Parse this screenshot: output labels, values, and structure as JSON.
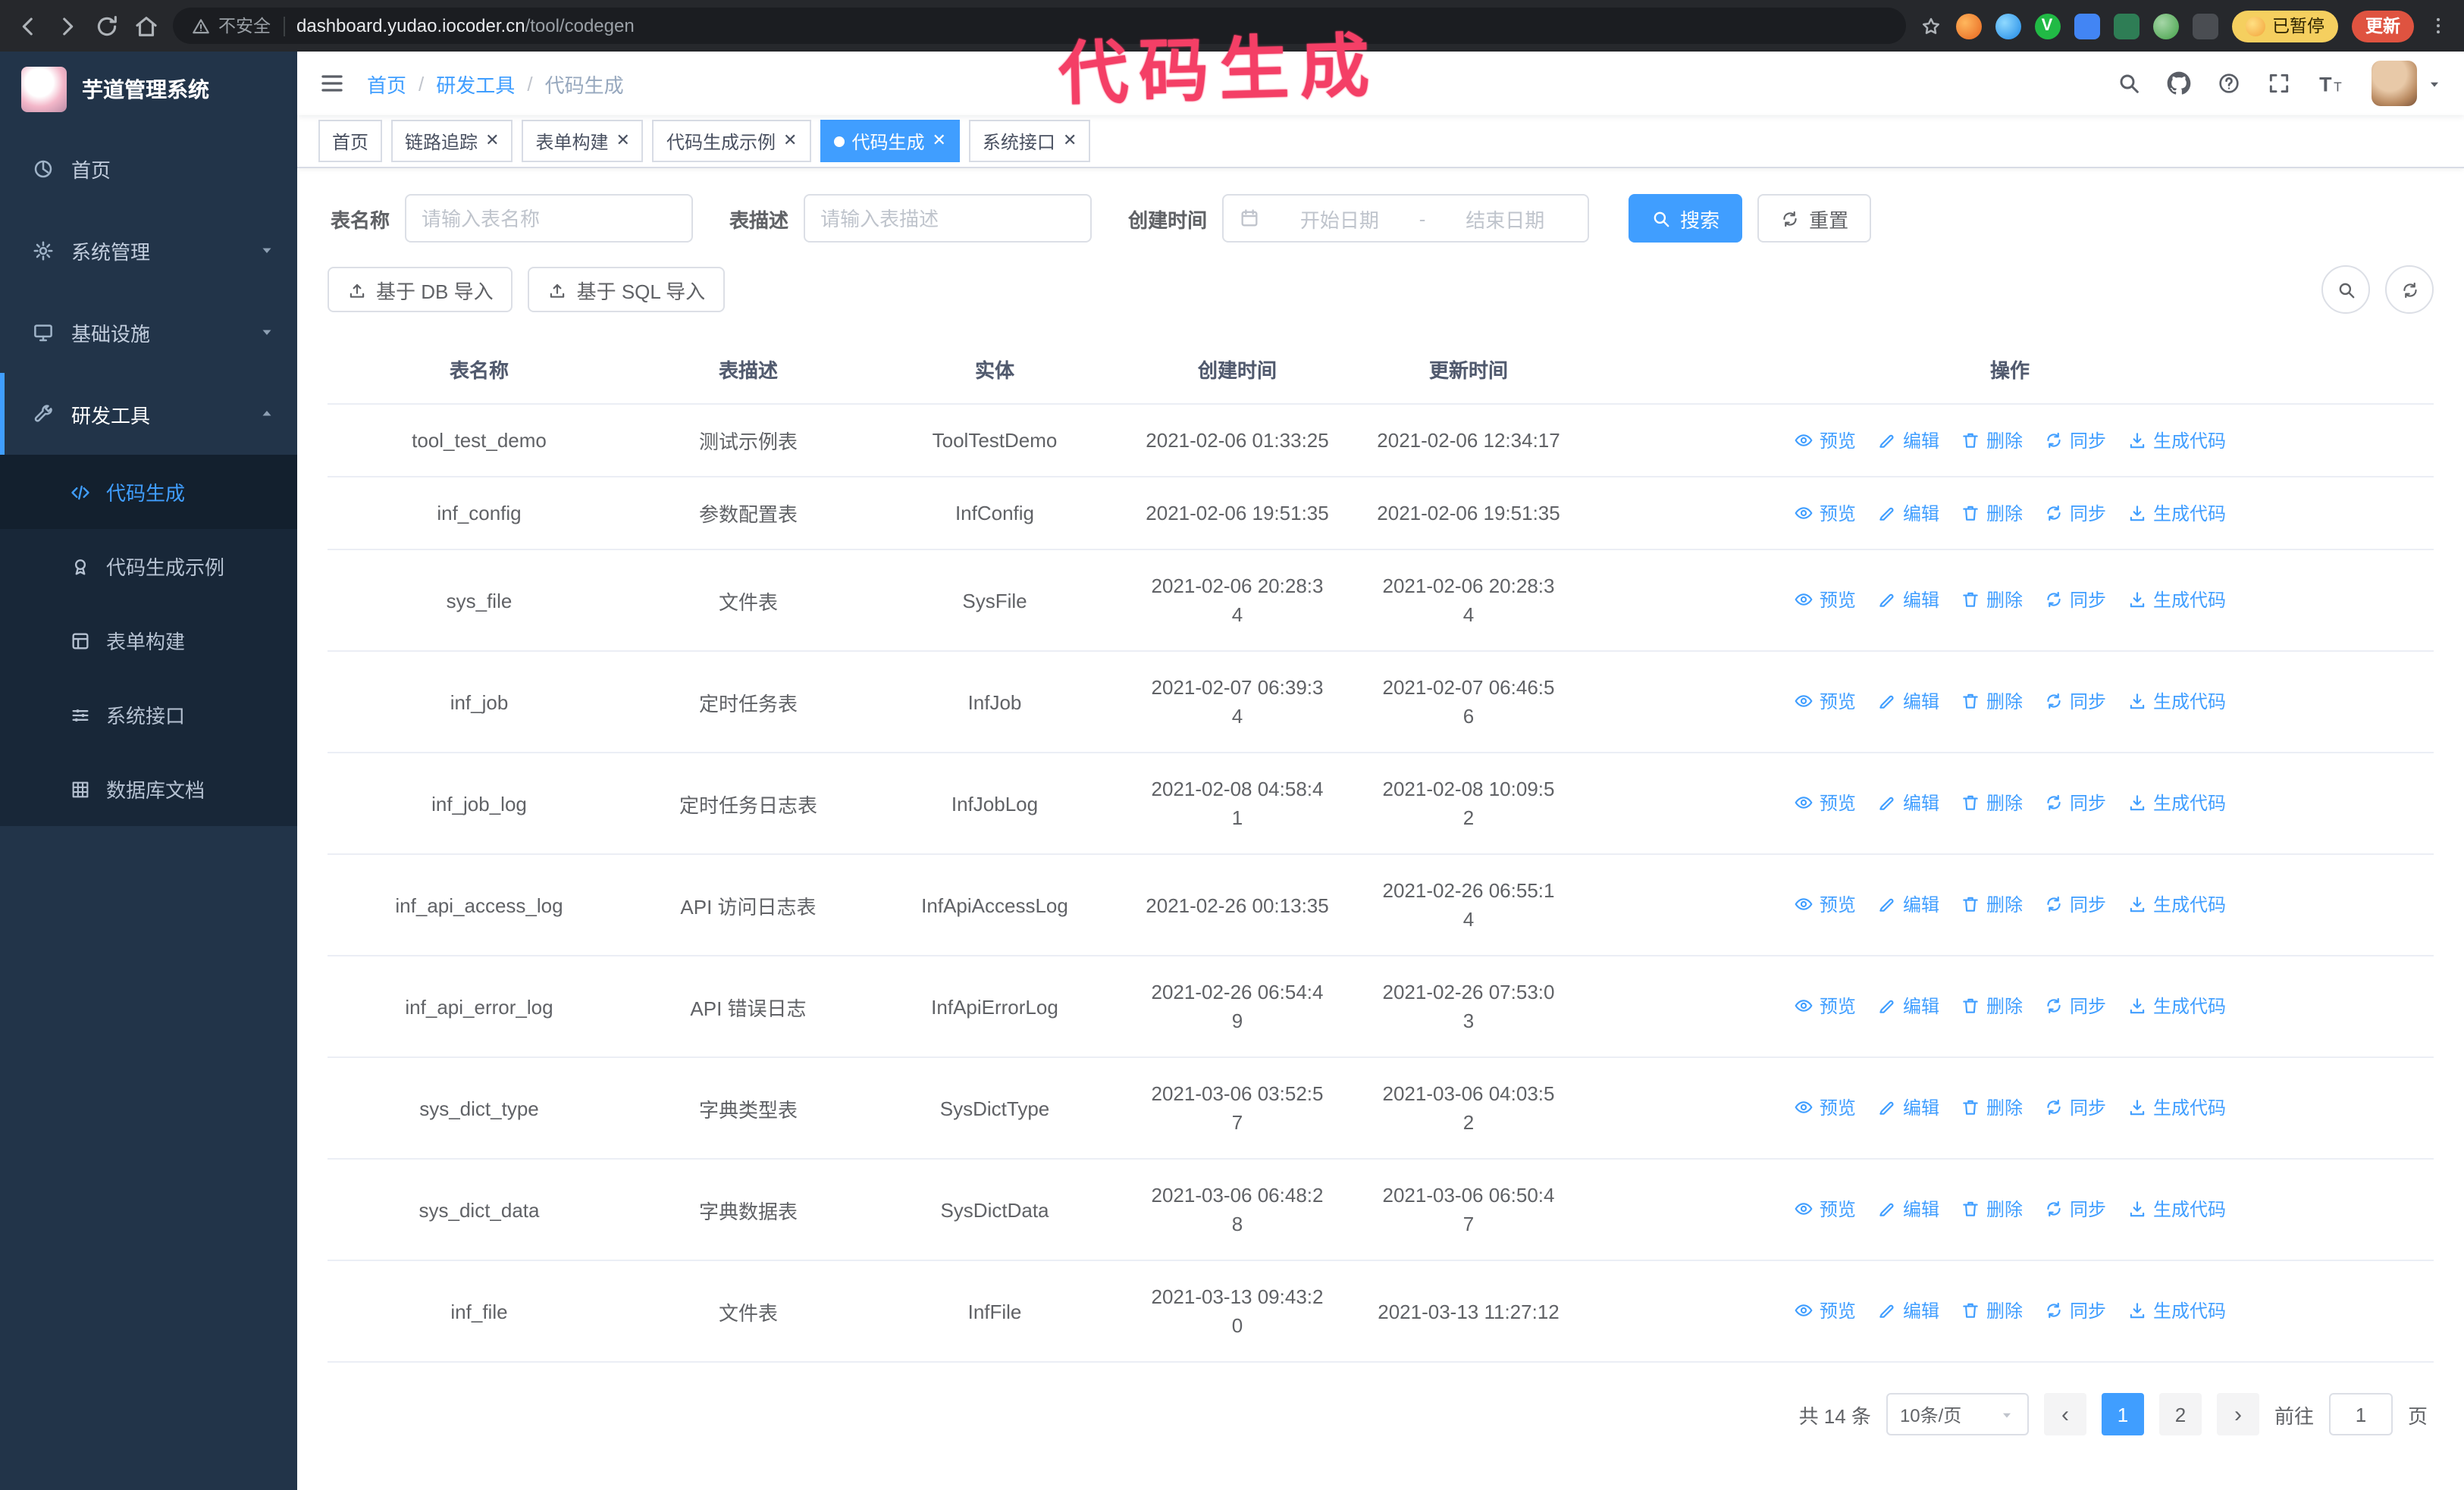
{
  "colors": {
    "accent": "#409eff",
    "sidebar_bg": "#223449",
    "submenu_bg": "#182738",
    "annotation": "#f43f66",
    "chrome_bg": "#26282c"
  },
  "browser": {
    "security_label": "不安全",
    "url_domain": "dashboard.yudao.iocoder.cn",
    "url_path": "/tool/codegen",
    "paused_badge": "已暂停",
    "update_button": "更新",
    "extensions": [
      "fox-extension",
      "droplet-extension",
      "v-circle-extension",
      "people-extension",
      "capture-extension",
      "leaf-extension",
      "puzzle-extension"
    ]
  },
  "annotation": {
    "text": "代码生成"
  },
  "sidebar": {
    "logo_title": "芋道管理系统",
    "menu": [
      {
        "label": "首页"
      },
      {
        "label": "系统管理"
      },
      {
        "label": "基础设施"
      },
      {
        "label": "研发工具"
      }
    ],
    "submenu": [
      {
        "label": "代码生成"
      },
      {
        "label": "代码生成示例"
      },
      {
        "label": "表单构建"
      },
      {
        "label": "系统接口"
      },
      {
        "label": "数据库文档"
      }
    ]
  },
  "header": {
    "breadcrumb": [
      "首页",
      "研发工具",
      "代码生成"
    ],
    "separator": "/"
  },
  "tabs": [
    {
      "label": "首页"
    },
    {
      "label": "链路追踪"
    },
    {
      "label": "表单构建"
    },
    {
      "label": "代码生成示例"
    },
    {
      "label": "代码生成"
    },
    {
      "label": "系统接口"
    }
  ],
  "filters": {
    "name_label": "表名称",
    "name_placeholder": "请输入表名称",
    "desc_label": "表描述",
    "desc_placeholder": "请输入表描述",
    "time_label": "创建时间",
    "start_placeholder": "开始日期",
    "range_separator": "-",
    "end_placeholder": "结束日期",
    "search_button": "搜索",
    "reset_button": "重置"
  },
  "toolbar": {
    "import_db_label": "基于 DB 导入",
    "import_sql_label": "基于 SQL 导入"
  },
  "table": {
    "headers": [
      "表名称",
      "表描述",
      "实体",
      "创建时间",
      "更新时间",
      "操作"
    ],
    "ops": {
      "preview": "预览",
      "edit": "编辑",
      "remove": "删除",
      "sync": "同步",
      "generate": "生成代码"
    },
    "rows": [
      {
        "name": "tool_test_demo",
        "desc": "测试示例表",
        "entity": "ToolTestDemo",
        "created": "2021-02-06 01:33:25",
        "updated": "2021-02-06 12:34:17"
      },
      {
        "name": "inf_config",
        "desc": "参数配置表",
        "entity": "InfConfig",
        "created": "2021-02-06 19:51:35",
        "updated": "2021-02-06 19:51:35"
      },
      {
        "name": "sys_file",
        "desc": "文件表",
        "entity": "SysFile",
        "created": "2021-02-06 20:28:3\n4",
        "updated": "2021-02-06 20:28:3\n4"
      },
      {
        "name": "inf_job",
        "desc": "定时任务表",
        "entity": "InfJob",
        "created": "2021-02-07 06:39:3\n4",
        "updated": "2021-02-07 06:46:5\n6"
      },
      {
        "name": "inf_job_log",
        "desc": "定时任务日志表",
        "entity": "InfJobLog",
        "created": "2021-02-08 04:58:4\n1",
        "updated": "2021-02-08 10:09:5\n2"
      },
      {
        "name": "inf_api_access_log",
        "desc": "API 访问日志表",
        "entity": "InfApiAccessLog",
        "created": "2021-02-26 00:13:35",
        "updated": "2021-02-26 06:55:1\n4"
      },
      {
        "name": "inf_api_error_log",
        "desc": "API 错误日志",
        "entity": "InfApiErrorLog",
        "created": "2021-02-26 06:54:4\n9",
        "updated": "2021-02-26 07:53:0\n3"
      },
      {
        "name": "sys_dict_type",
        "desc": "字典类型表",
        "entity": "SysDictType",
        "created": "2021-03-06 03:52:5\n7",
        "updated": "2021-03-06 04:03:5\n2"
      },
      {
        "name": "sys_dict_data",
        "desc": "字典数据表",
        "entity": "SysDictData",
        "created": "2021-03-06 06:48:2\n8",
        "updated": "2021-03-06 06:50:4\n7"
      },
      {
        "name": "inf_file",
        "desc": "文件表",
        "entity": "InfFile",
        "created": "2021-03-13 09:43:2\n0",
        "updated": "2021-03-13 11:27:12"
      }
    ]
  },
  "pagination": {
    "total": "共 14 条",
    "page_size": "10条/页",
    "prev": "‹",
    "next": "›",
    "pages": [
      "1",
      "2"
    ],
    "goto_label": "前往",
    "goto_value": "1",
    "unit_label": "页"
  }
}
